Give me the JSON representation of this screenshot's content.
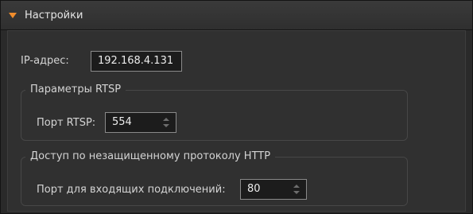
{
  "section": {
    "title": "Настройки",
    "expand_icon": "triangle-down-icon",
    "accent_color": "#f08d2c"
  },
  "ip": {
    "label": "IP-адрес:",
    "value": "192.168.4.131"
  },
  "rtsp": {
    "group_title": "Параметры RTSP",
    "port_label": "Порт RTSP:",
    "port_value": "554"
  },
  "http": {
    "group_title": "Доступ по незащищенному протоколу HTTP",
    "port_label": "Порт для входящих подключений:",
    "port_value": "80"
  }
}
